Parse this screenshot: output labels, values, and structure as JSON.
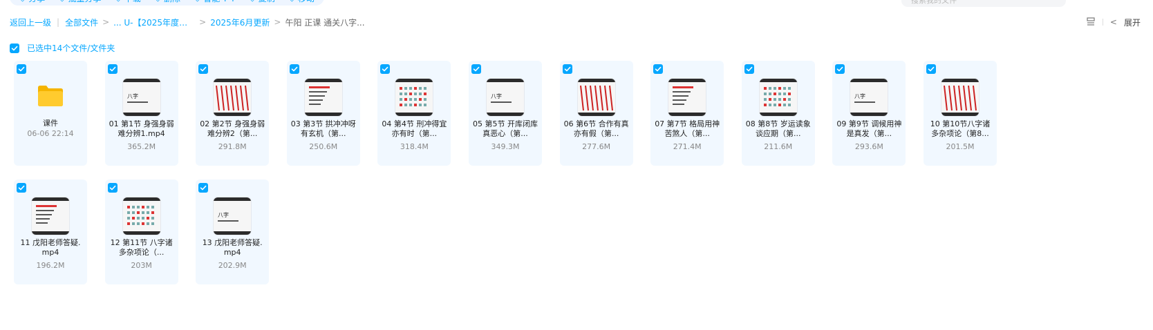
{
  "toolbar": {
    "items": [
      {
        "label": "分享",
        "icon": "share-icon"
      },
      {
        "label": "批量分享",
        "icon": "batch-share-icon"
      },
      {
        "label": "下载",
        "icon": "download-icon"
      },
      {
        "label": "删除",
        "icon": "delete-icon"
      },
      {
        "label": "智能 T T",
        "icon": "smart-icon"
      },
      {
        "label": "复制",
        "icon": "copy-icon"
      },
      {
        "label": "移动",
        "icon": "move-icon"
      }
    ],
    "search_placeholder": "搜索我的文件"
  },
  "breadcrumb": {
    "back": "返回上一级",
    "root": "全部文件",
    "level1": "... U-【2025年度整理...",
    "level2": "2025年6月更新",
    "current": "午阳 正课 通关八字..."
  },
  "right_tools": {
    "expand_label": "展开"
  },
  "selection": {
    "label": "已选中14个文件/文件夹"
  },
  "accent_color": "#06a7ff",
  "files": [
    {
      "name": "课件",
      "meta": "06-06 22:14",
      "type": "folder",
      "selected": true
    },
    {
      "name": "01 第1节 身强身弱难分辨1.mp4",
      "meta": "365.2M",
      "type": "video",
      "selected": true
    },
    {
      "name": "02 第2节 身强身弱难分辨2（第...",
      "meta": "291.8M",
      "type": "video",
      "selected": true
    },
    {
      "name": "03 第3节 拱冲冲呀有玄机（第...",
      "meta": "250.6M",
      "type": "video",
      "selected": true
    },
    {
      "name": "04 第4节 刑冲得宜亦有时（第...",
      "meta": "318.4M",
      "type": "video",
      "selected": true
    },
    {
      "name": "05 第5节 开库闭库真恶心（第...",
      "meta": "349.3M",
      "type": "video",
      "selected": true
    },
    {
      "name": "06 第6节 合作有真亦有假（第...",
      "meta": "277.6M",
      "type": "video",
      "selected": true
    },
    {
      "name": "07 第7节 格局用神苦煞人（第...",
      "meta": "271.4M",
      "type": "video",
      "selected": true
    },
    {
      "name": "08 第8节 岁运读象谈应期（第...",
      "meta": "211.6M",
      "type": "video",
      "selected": true
    },
    {
      "name": "09 第9节 调候用神是真发（第...",
      "meta": "293.6M",
      "type": "video",
      "selected": true
    },
    {
      "name": "10 第10节八字诸多杂项论（第8...",
      "meta": "201.5M",
      "type": "video",
      "selected": true
    },
    {
      "name": "11 戊阳老师答疑.mp4",
      "meta": "196.2M",
      "type": "video",
      "selected": true
    },
    {
      "name": "12 第11节 八字诸多杂项论（...",
      "meta": "203M",
      "type": "video",
      "selected": true
    },
    {
      "name": "13 戊阳老师答疑.mp4",
      "meta": "202.9M",
      "type": "video",
      "selected": true
    }
  ]
}
